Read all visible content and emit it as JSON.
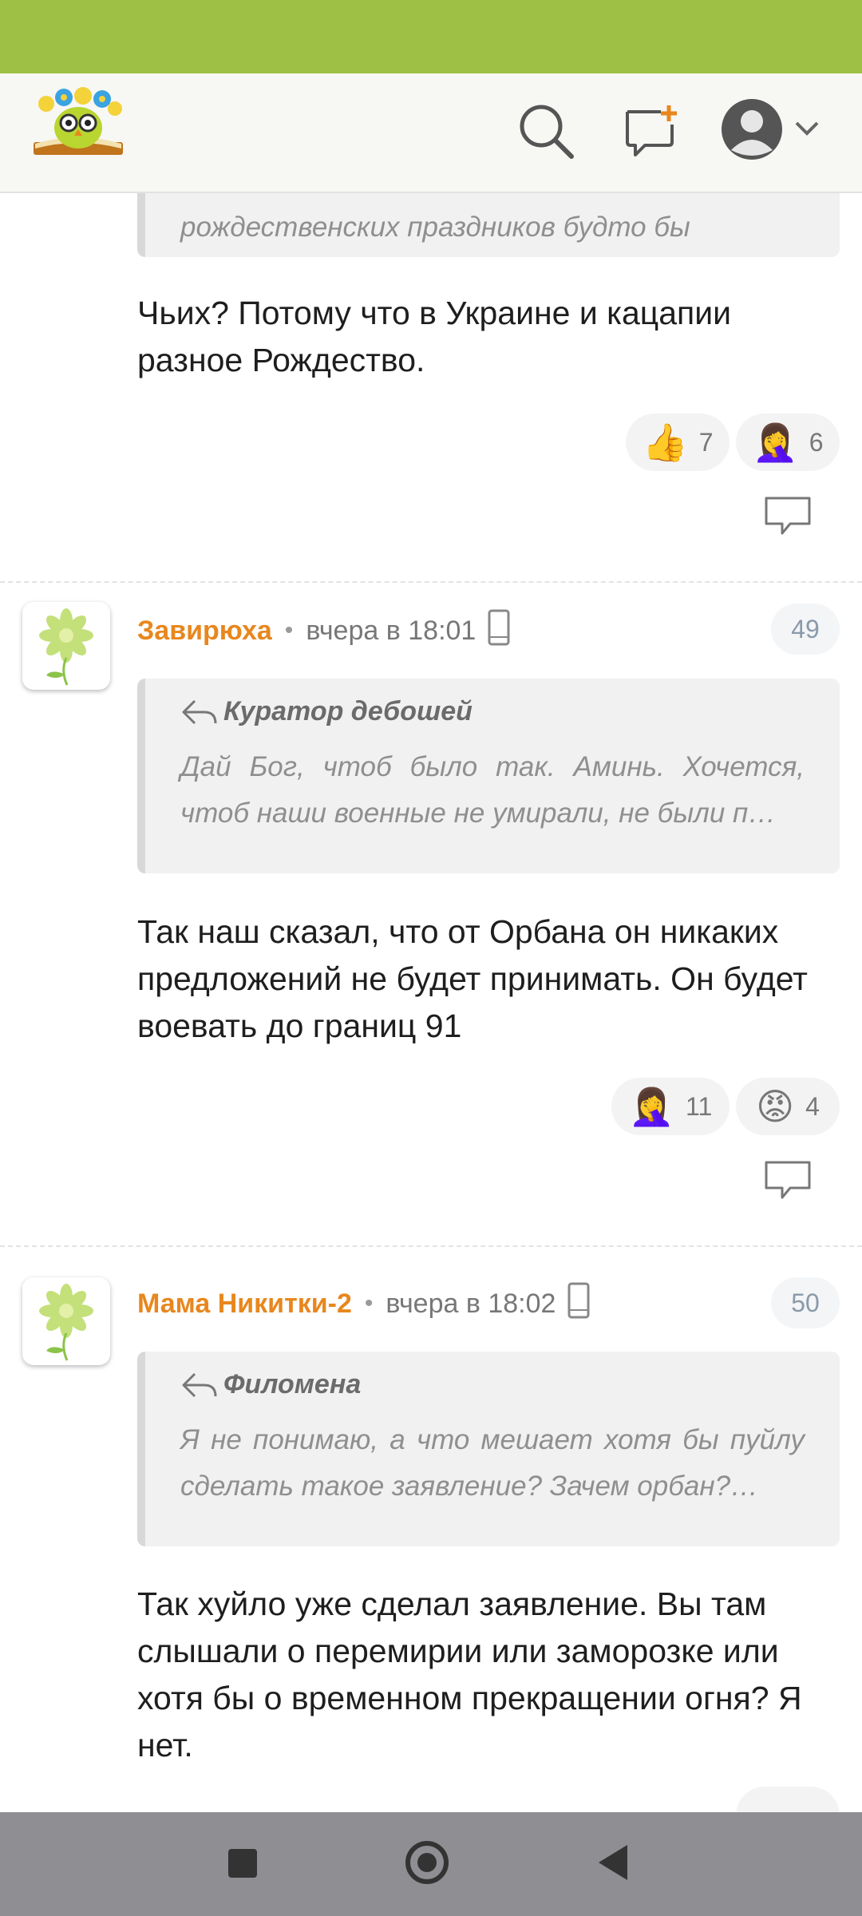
{
  "header": {
    "logo_icon": "owl-book-logo-icon",
    "search_icon": "search-icon",
    "new_post_icon": "new-post-icon",
    "avatar_icon": "user-avatar-icon",
    "dropdown_icon": "chevron-down-icon"
  },
  "posts": [
    {
      "quote_tail": "рождественских праздников будто бы",
      "text": "Чьих? Потому что в Украине и кацапии разное Рождество.",
      "reactions": [
        {
          "emoji": "👍",
          "count": "7"
        },
        {
          "emoji": "🤦‍♀️",
          "count": "6"
        }
      ]
    },
    {
      "author": "Завирюха",
      "time": "вчера в 18:01",
      "number": "49",
      "quote": {
        "author": "Куратор дебошей",
        "text": "Дай Бог, чтоб было так. Аминь. Хочется, чтоб наши военные не умирали, не были п…"
      },
      "text": "Так наш сказал, что от Орбана он никаких предложений не будет принимать. Он будет воевать до границ 91",
      "reactions": [
        {
          "emoji": "🤦‍♀️",
          "count": "11"
        },
        {
          "emoji": "😡",
          "count": "4"
        }
      ]
    },
    {
      "author": "Мама Никитки-2",
      "time": "вчера в 18:02",
      "number": "50",
      "quote": {
        "author": "Филомена",
        "text": "Я не понимаю, а что мешает хотя бы пуйлу сделать такое заявление? Зачем орбан?…"
      },
      "text": "Так хуйло уже сделал заявление. Вы там слышали о перемирии или заморозке или хотя бы о временном прекращении огня? Я нет."
    }
  ],
  "colors": {
    "status_bar": "#9dc045",
    "username": "#e8871e",
    "nav_bar": "#8e8e93"
  }
}
